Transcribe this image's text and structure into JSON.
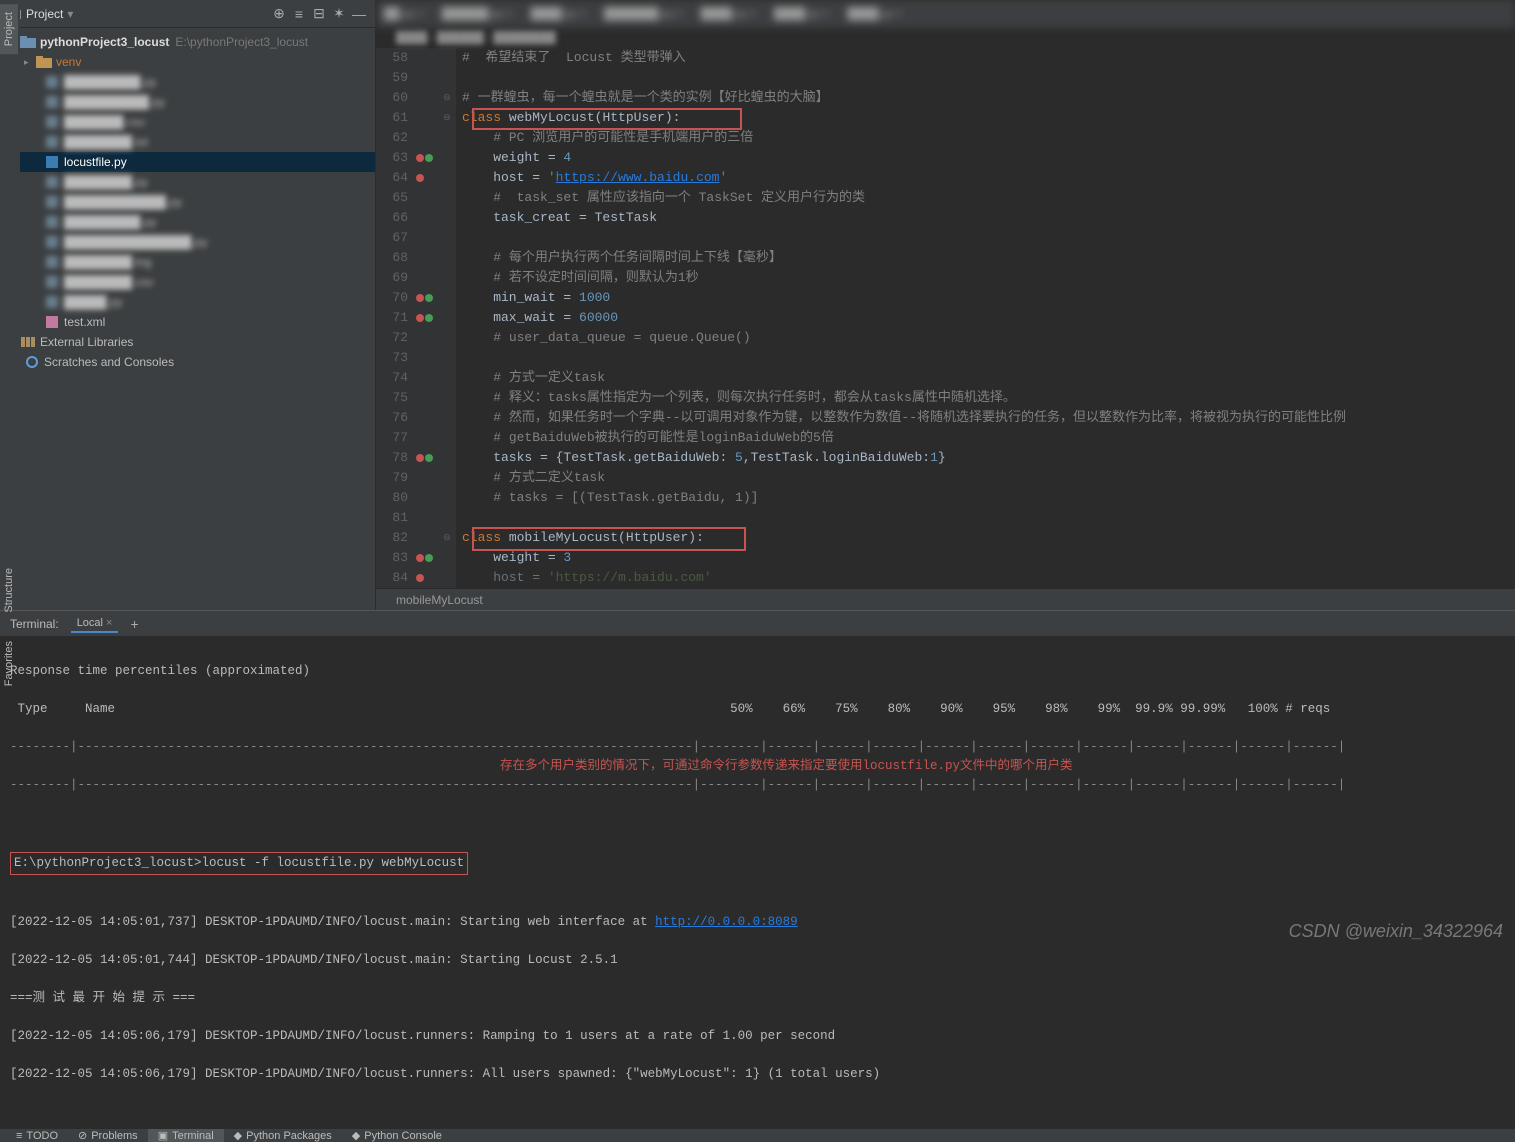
{
  "project": {
    "header": "Project",
    "root_name": "pythonProject3_locust",
    "root_path": "E:\\pythonProject3_locust",
    "venv": "venv",
    "selected_file": "locustfile.py",
    "test_xml": "test.xml",
    "ext_libs": "External Libraries",
    "scratches": "Scratches and Consoles"
  },
  "side": {
    "project": "Project",
    "structure": "Structure",
    "favorites": "Favorites"
  },
  "editor": {
    "breadcrumb_bottom": "mobileMyLocust",
    "lines": [
      {
        "n": 58,
        "html": "<span class='cm'>#  希望结束了  Locust 类型带弹入</span>"
      },
      {
        "n": 59,
        "html": ""
      },
      {
        "n": 60,
        "html": "<span class='cm'># 一群蝗虫，每一个蝗虫就是一个类的实例【好比蝗虫的大脑】</span>"
      },
      {
        "n": 61,
        "html": "<span class='kw'>class </span><span class='cls'>webMyLocust</span>(<span class='cls'>HttpUser</span>):",
        "mark": ""
      },
      {
        "n": 62,
        "html": "    <span class='cm'># PC 浏览用户的可能性是手机端用户的三倍</span>"
      },
      {
        "n": 63,
        "html": "    weight = <span class='num'>4</span>",
        "mark": "ot"
      },
      {
        "n": 64,
        "html": "    host = <span class='str'>'</span><span class='url'>https://www.baidu.com</span><span class='str'>'</span>",
        "mark": "o"
      },
      {
        "n": 65,
        "html": "    <span class='cm'>#  task_set 属性应该指向一个 TaskSet 定义用户行为的类</span>"
      },
      {
        "n": 66,
        "html": "    task_creat = TestTask"
      },
      {
        "n": 67,
        "html": ""
      },
      {
        "n": 68,
        "html": "    <span class='cm'># 每个用户执行两个任务间隔时间上下线【毫秒】</span>"
      },
      {
        "n": 69,
        "html": "    <span class='cm'># 若不设定时间间隔，则默认为1秒</span>"
      },
      {
        "n": 70,
        "html": "    min_wait = <span class='num'>1000</span>",
        "mark": "ot"
      },
      {
        "n": 71,
        "html": "    max_wait = <span class='num'>60000</span>",
        "mark": "ot"
      },
      {
        "n": 72,
        "html": "    <span class='cm'># user_data_queue = queue.Queue()</span>"
      },
      {
        "n": 73,
        "html": ""
      },
      {
        "n": 74,
        "html": "    <span class='cm'># 方式一定义task</span>"
      },
      {
        "n": 75,
        "html": "    <span class='cm'># 释义：tasks属性指定为一个列表，则每次执行任务时，都会从tasks属性中随机选择。</span>"
      },
      {
        "n": 76,
        "html": "    <span class='cm'># 然而，如果任务时一个字典--以可调用对象作为键，以整数作为数值--将随机选择要执行的任务，但以整数作为比率，将被视为执行的可能性比例</span>"
      },
      {
        "n": 77,
        "html": "    <span class='cm'># getBaiduWeb被执行的可能性是loginBaiduWeb的5倍</span>"
      },
      {
        "n": 78,
        "html": "    tasks = {TestTask.getBaiduWeb: <span class='num'>5</span>,TestTask.loginBaiduWeb:<span class='num'>1</span>}",
        "mark": "ot"
      },
      {
        "n": 79,
        "html": "    <span class='cm'># 方式二定义task</span>"
      },
      {
        "n": 80,
        "html": "    <span class='cm'># tasks = [(TestTask.getBaidu, 1)]</span>"
      },
      {
        "n": 81,
        "html": ""
      },
      {
        "n": 82,
        "html": "<span class='kw'>class </span><span class='cls'>mobileMyLocust</span>(<span class='cls'>HttpUser</span>):"
      },
      {
        "n": 83,
        "html": "    weight = <span class='num'>3</span>",
        "mark": "ot"
      },
      {
        "n": 84,
        "html": "    host = <span class='str'>'https://m.baidu.com'</span>",
        "mark": "o",
        "dim": true
      }
    ]
  },
  "terminal": {
    "label": "Terminal:",
    "tab": "Local",
    "header1": "Response time percentiles (approximated)",
    "cols": " Type     Name                                                                                  50%    66%    75%    80%    90%    95%    98%    99%  99.9% 99.99%   100% # reqs",
    "sep": "--------|----------------------------------------------------------------------------------|--------|------|------|------|------|------|------|------|------|------|------|------|",
    "sep2": "--------|----------------------------------------------------------------------------------|--------|------|------|------|------|------|------|------|------|------|------|------|",
    "blank": "",
    "cmd_prompt": "E:\\pythonProject3_locust>",
    "cmd": "locust -f locustfile.py webMyLocust",
    "annotation": "存在多个用户类别的情况下，可通过命令行参数传递来指定要使用locustfile.py文件中的哪个用户类",
    "log1a": "[2022-12-05 14:05:01,737] DESKTOP-1PDAUMD/INFO/locust.main: Starting web interface at ",
    "log1b": "http://0.0.0.0:8089",
    "log2": "[2022-12-05 14:05:01,744] DESKTOP-1PDAUMD/INFO/locust.main: Starting Locust 2.5.1",
    "log3": "===测 试 最 开 始 提 示 ===",
    "log4": "[2022-12-05 14:05:06,179] DESKTOP-1PDAUMD/INFO/locust.runners: Ramping to 1 users at a rate of 1.00 per second",
    "log5": "[2022-12-05 14:05:06,179] DESKTOP-1PDAUMD/INFO/locust.runners: All users spawned: {\"webMyLocust\": 1} (1 total users)"
  },
  "bottom": {
    "todo": "TODO",
    "problems": "Problems",
    "terminal": "Terminal",
    "pypkg": "Python Packages",
    "pycon": "Python Console"
  },
  "watermark": "CSDN @weixin_34322964"
}
